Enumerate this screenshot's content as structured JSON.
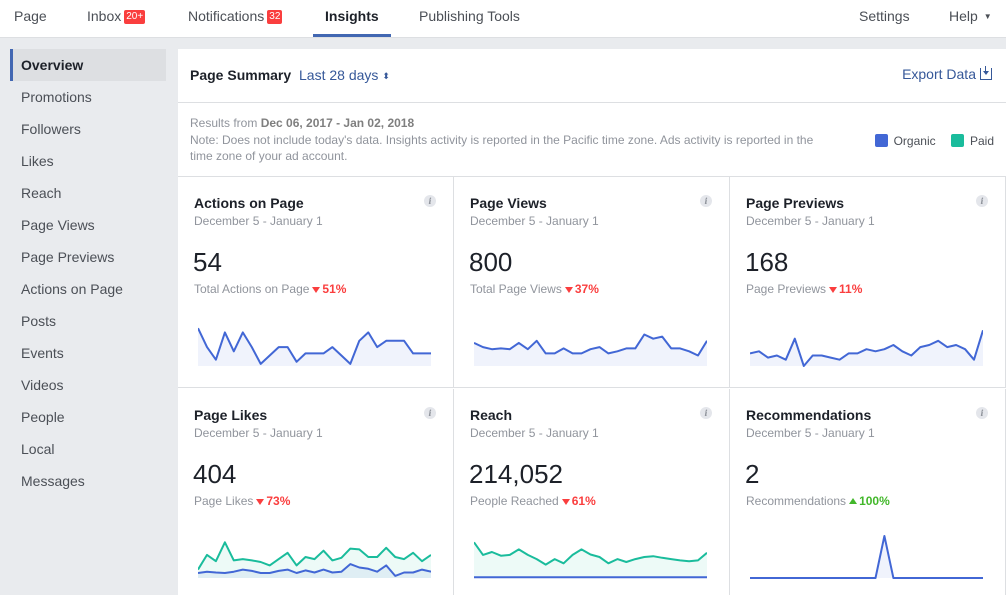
{
  "nav": {
    "items": [
      {
        "label": "Page",
        "badge": null,
        "active": false
      },
      {
        "label": "Inbox",
        "badge": "20+",
        "active": false
      },
      {
        "label": "Notifications",
        "badge": "32",
        "active": false
      },
      {
        "label": "Insights",
        "badge": null,
        "active": true
      },
      {
        "label": "Publishing Tools",
        "badge": null,
        "active": false
      }
    ],
    "settings_label": "Settings",
    "help_label": "Help",
    "help_caret": "▼"
  },
  "sidebar": {
    "items": [
      {
        "label": "Overview",
        "active": true
      },
      {
        "label": "Promotions"
      },
      {
        "label": "Followers"
      },
      {
        "label": "Likes"
      },
      {
        "label": "Reach"
      },
      {
        "label": "Page Views"
      },
      {
        "label": "Page Previews"
      },
      {
        "label": "Actions on Page"
      },
      {
        "label": "Posts"
      },
      {
        "label": "Events"
      },
      {
        "label": "Videos"
      },
      {
        "label": "People"
      },
      {
        "label": "Local"
      },
      {
        "label": "Messages"
      }
    ]
  },
  "summary": {
    "title": "Page Summary",
    "period": "Last 28 days",
    "period_icon": "⬍",
    "export_label": "Export Data",
    "results_prefix": "Results from ",
    "results_range": "Dec 06, 2017 - Jan 02, 2018",
    "note": "Note: Does not include today's data. Insights activity is reported in the Pacific time zone. Ads activity is reported in the time zone of your ad account.",
    "legend": [
      {
        "label": "Organic",
        "color": "#4267d5"
      },
      {
        "label": "Paid",
        "color": "#1abc9c"
      }
    ]
  },
  "colors": {
    "accent": "#4267b2",
    "link": "#365899",
    "organic": "#4267d5",
    "paid": "#1abc9c",
    "down": "#fa3e3e",
    "up": "#42b72a"
  },
  "cards": [
    {
      "title": "Actions on Page",
      "range": "December 5 - January 1",
      "value": "54",
      "label": "Total Actions on Page",
      "change": "51%",
      "direction": "down",
      "organic": [
        0.9,
        0.45,
        0.15,
        0.8,
        0.35,
        0.8,
        0.45,
        0.05,
        0.25,
        0.45,
        0.45,
        0.1,
        0.3,
        0.3,
        0.3,
        0.45,
        0.25,
        0.05,
        0.6,
        0.8,
        0.45,
        0.6,
        0.6,
        0.6,
        0.3,
        0.3,
        0.3
      ],
      "paid": null
    },
    {
      "title": "Page Views",
      "range": "December 5 - January 1",
      "value": "800",
      "label": "Total Page Views",
      "change": "37%",
      "direction": "down",
      "organic": [
        0.55,
        0.45,
        0.4,
        0.42,
        0.4,
        0.55,
        0.4,
        0.6,
        0.3,
        0.3,
        0.42,
        0.3,
        0.3,
        0.4,
        0.45,
        0.3,
        0.35,
        0.42,
        0.42,
        0.75,
        0.65,
        0.7,
        0.42,
        0.42,
        0.35,
        0.25,
        0.6
      ],
      "paid": null
    },
    {
      "title": "Page Previews",
      "range": "December 5 - January 1",
      "value": "168",
      "label": "Page Previews",
      "change": "11%",
      "direction": "down",
      "organic": [
        0.3,
        0.35,
        0.2,
        0.25,
        0.15,
        0.65,
        0.0,
        0.25,
        0.25,
        0.2,
        0.15,
        0.3,
        0.3,
        0.4,
        0.35,
        0.4,
        0.5,
        0.35,
        0.25,
        0.45,
        0.5,
        0.6,
        0.45,
        0.5,
        0.4,
        0.15,
        0.85
      ],
      "paid": null
    },
    {
      "title": "Page Likes",
      "range": "December 5 - January 1",
      "value": "404",
      "label": "Page Likes",
      "change": "73%",
      "direction": "down",
      "organic": [
        0.12,
        0.15,
        0.13,
        0.12,
        0.15,
        0.2,
        0.17,
        0.12,
        0.12,
        0.17,
        0.2,
        0.12,
        0.18,
        0.13,
        0.2,
        0.13,
        0.15,
        0.33,
        0.25,
        0.22,
        0.15,
        0.3,
        0.05,
        0.13,
        0.13,
        0.2,
        0.15
      ],
      "paid": [
        0.2,
        0.55,
        0.4,
        0.85,
        0.42,
        0.45,
        0.42,
        0.38,
        0.3,
        0.45,
        0.6,
        0.3,
        0.5,
        0.45,
        0.65,
        0.42,
        0.48,
        0.7,
        0.68,
        0.5,
        0.5,
        0.72,
        0.5,
        0.45,
        0.6,
        0.4,
        0.55
      ]
    },
    {
      "title": "Reach",
      "range": "December 5 - January 1",
      "value": "214,052",
      "label": "People Reached",
      "change": "61%",
      "direction": "down",
      "organic": [
        0.02,
        0.02,
        0.02,
        0.02,
        0.02,
        0.02,
        0.02,
        0.02,
        0.02,
        0.02,
        0.02,
        0.02,
        0.02,
        0.02,
        0.02,
        0.02,
        0.02,
        0.02,
        0.02,
        0.02,
        0.02,
        0.02,
        0.02,
        0.02,
        0.02,
        0.02,
        0.02
      ],
      "paid": [
        0.85,
        0.55,
        0.62,
        0.53,
        0.55,
        0.68,
        0.55,
        0.45,
        0.32,
        0.45,
        0.35,
        0.55,
        0.68,
        0.56,
        0.5,
        0.35,
        0.45,
        0.38,
        0.45,
        0.5,
        0.52,
        0.48,
        0.45,
        0.42,
        0.4,
        0.42,
        0.6
      ]
    },
    {
      "title": "Recommendations",
      "range": "December 5 - January 1",
      "value": "2",
      "label": "Recommendations",
      "change": "100%",
      "direction": "up",
      "organic": [
        0,
        0,
        0,
        0,
        0,
        0,
        0,
        0,
        0,
        0,
        0,
        0,
        0,
        0,
        0,
        1,
        0,
        0,
        0,
        0,
        0,
        0,
        0,
        0,
        0,
        0,
        0
      ],
      "paid": null
    }
  ]
}
